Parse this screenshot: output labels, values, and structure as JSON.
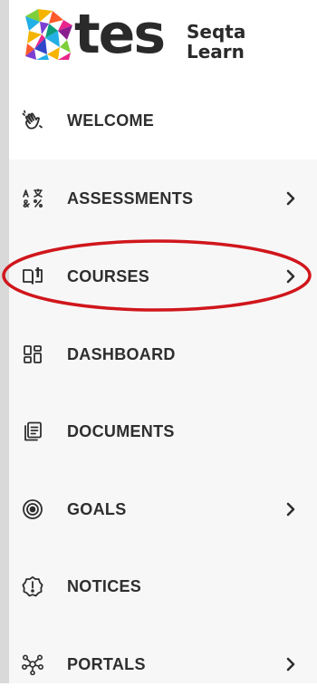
{
  "brand": {
    "logo_text": "tes",
    "product_line1": "Seqta",
    "product_line2": "Learn"
  },
  "nav": {
    "items": [
      {
        "label": "WELCOME",
        "icon": "hand-wave-icon",
        "has_submenu": false
      },
      {
        "label": "ASSESSMENTS",
        "icon": "translate-symbols-icon",
        "has_submenu": true
      },
      {
        "label": "COURSES",
        "icon": "open-book-icon",
        "has_submenu": true
      },
      {
        "label": "DASHBOARD",
        "icon": "dashboard-grid-icon",
        "has_submenu": false
      },
      {
        "label": "DOCUMENTS",
        "icon": "documents-stack-icon",
        "has_submenu": false
      },
      {
        "label": "GOALS",
        "icon": "target-icon",
        "has_submenu": true
      },
      {
        "label": "NOTICES",
        "icon": "alert-badge-icon",
        "has_submenu": false
      },
      {
        "label": "PORTALS",
        "icon": "network-hub-icon",
        "has_submenu": true
      }
    ]
  },
  "annotation": {
    "color": "#d0161c",
    "target": "COURSES"
  },
  "colors": {
    "text": "#2e2e2e",
    "sidebar_bg": "#f7f7f7",
    "active_bg": "#ffffff",
    "left_edge": "#d9d9d9"
  }
}
